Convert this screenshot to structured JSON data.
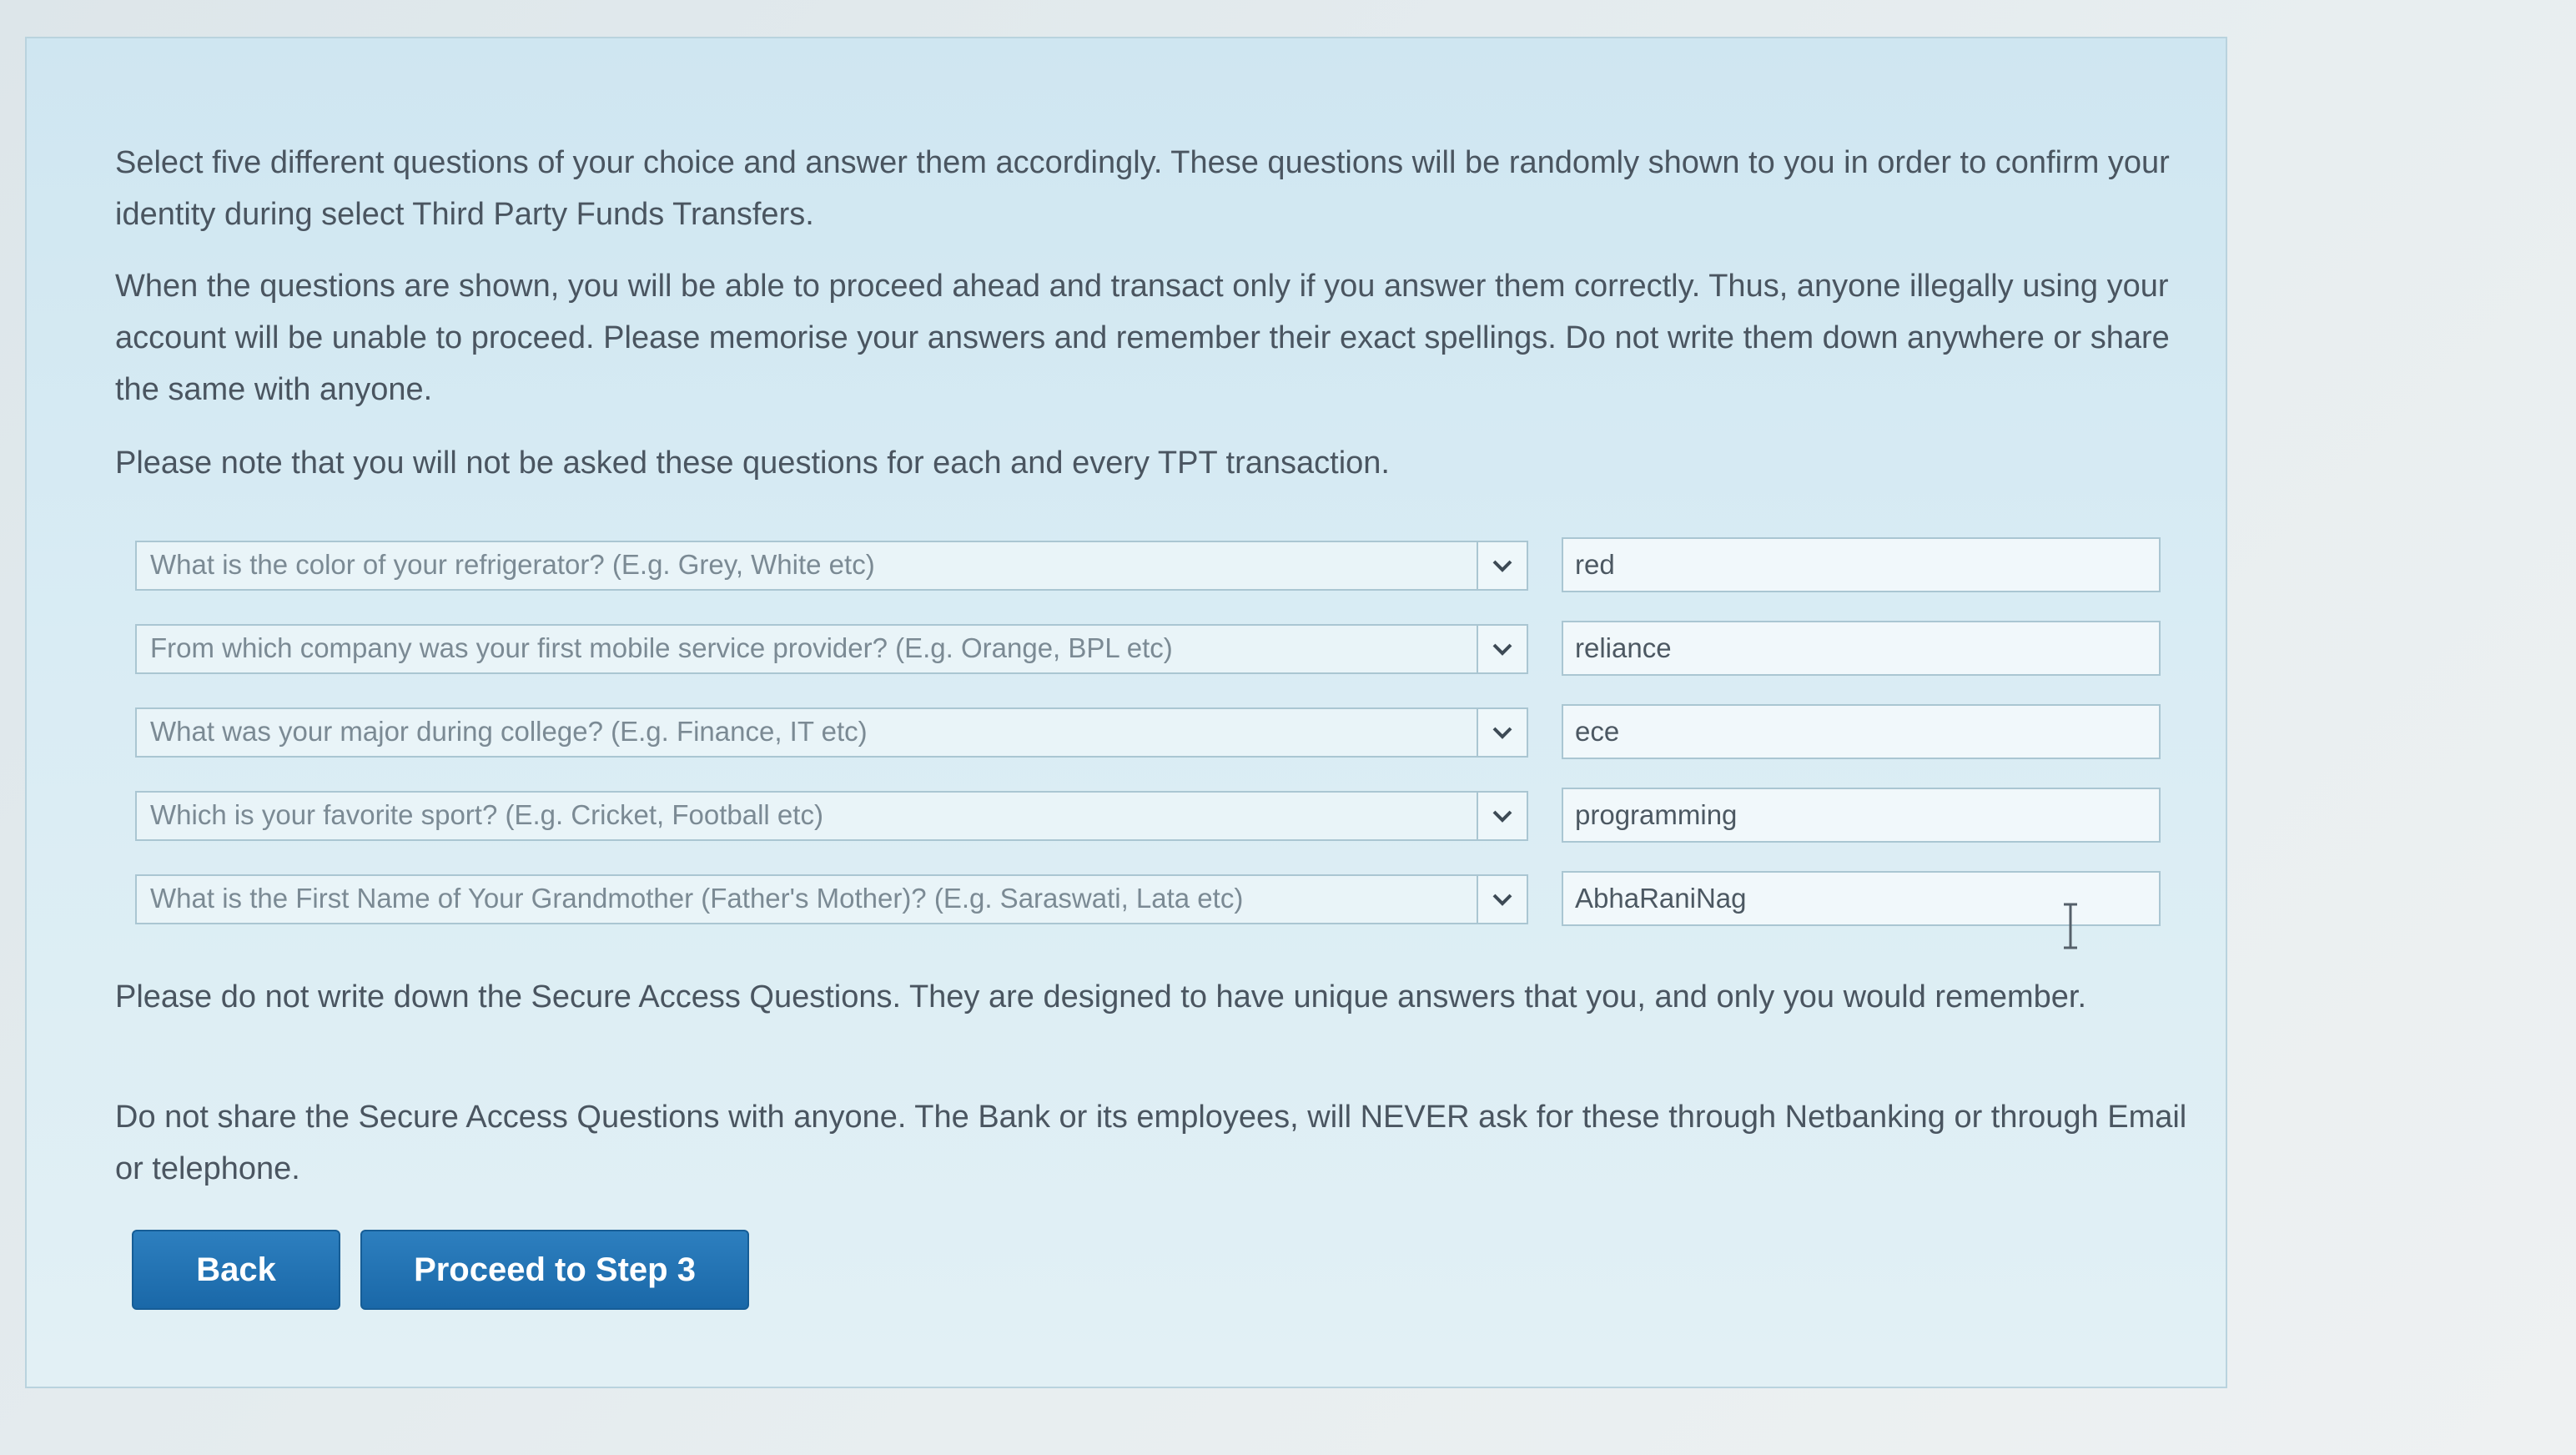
{
  "intro": {
    "p1": "Select five different questions of your choice and answer them accordingly. These questions will be randomly shown to you in order to confirm your identity during select Third Party Funds Transfers.",
    "p2": "When the questions are shown, you will be able to proceed ahead and transact only if you answer them correctly. Thus, anyone illegally using your account will be unable to proceed. Please memorise your answers and remember their exact spellings. Do not write them down anywhere or share the same with anyone.",
    "p3": "Please note that you will not be asked these questions for each and every TPT transaction."
  },
  "questions": [
    {
      "question": "What is the color of your refrigerator? (E.g. Grey, White etc)",
      "answer": "red"
    },
    {
      "question": "From which company was your first mobile service provider? (E.g. Orange, BPL etc)",
      "answer": "reliance"
    },
    {
      "question": "What was your major during college? (E.g. Finance, IT etc)",
      "answer": "ece"
    },
    {
      "question": "Which is your favorite sport? (E.g. Cricket, Football etc)",
      "answer": "programming"
    },
    {
      "question": "What is the First Name of Your Grandmother (Father's Mother)? (E.g. Saraswati, Lata etc)",
      "answer": "AbhaRaniNag"
    }
  ],
  "notes": {
    "p4": "Please do not write down the Secure Access Questions. They are designed to have unique answers that you, and only you would remember.",
    "p5": "Do not share the Secure Access Questions with anyone. The Bank or its employees, will NEVER ask for these through Netbanking or through Email or telephone."
  },
  "buttons": {
    "back": "Back",
    "proceed": "Proceed to Step 3"
  },
  "icons": {
    "dropdown": "chevron-down-icon",
    "cursor": "text-cursor-icon"
  },
  "colors": {
    "button": "#1f6fb0",
    "panel": "#d6eaf3"
  }
}
